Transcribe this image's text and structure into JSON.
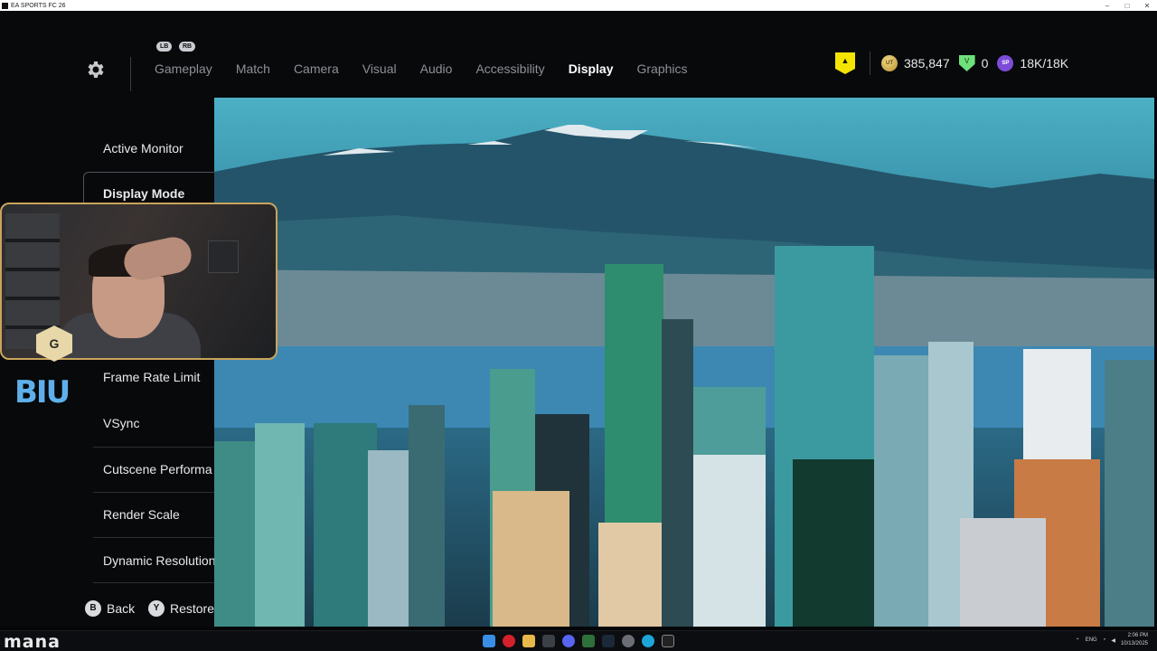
{
  "window": {
    "title": "EA SPORTS FC 26",
    "min": "–",
    "max": "□",
    "close": "✕"
  },
  "header": {
    "bumper_left": "LB",
    "bumper_right": "RB",
    "tabs": [
      "Gameplay",
      "Match",
      "Camera",
      "Visual",
      "Audio",
      "Accessibility",
      "Display",
      "Graphics"
    ],
    "active_tab": "Display",
    "currency": {
      "coins_icon": "UT",
      "coins": "385,847",
      "points_icon": "V",
      "points": "0",
      "sp_icon": "SP",
      "sp": "18K/18K"
    }
  },
  "settings": {
    "items": [
      "Active Monitor",
      "Display Mode",
      "Frame Rate Limit",
      "VSync",
      "Cutscene Performa",
      "Render Scale",
      "Dynamic Resolution"
    ],
    "selected": "Display Mode"
  },
  "footer": {
    "back_button": "B",
    "back_label": "Back",
    "restore_button": "Y",
    "restore_label": "Restore"
  },
  "taskbar": {
    "brand": "mana",
    "language": "ENG",
    "time": "2:06 PM",
    "date": "10/13/2025"
  },
  "colors": {
    "accent_gold": "#c9a45a",
    "club_yellow": "#f3e500",
    "background": "#07090b"
  }
}
